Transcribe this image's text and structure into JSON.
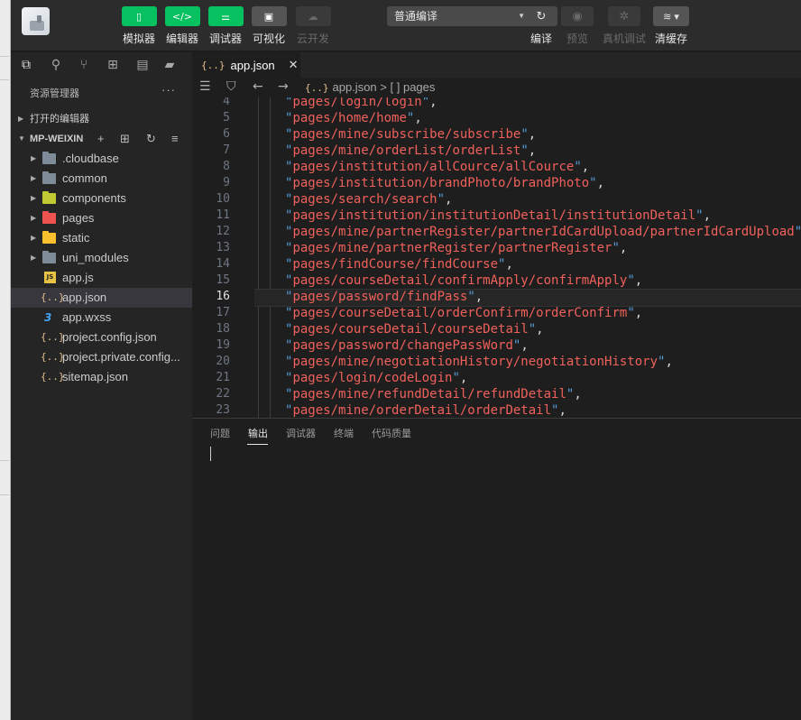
{
  "toolbar": {
    "buttons": [
      {
        "label": "模拟器"
      },
      {
        "label": "编辑器"
      },
      {
        "label": "调试器"
      },
      {
        "label": "可视化"
      },
      {
        "label": "云开发"
      }
    ],
    "compile_mode": "普通编译",
    "right_buttons": [
      {
        "label": "编译"
      },
      {
        "label": "预览"
      },
      {
        "label": "真机调试"
      },
      {
        "label": "清缓存"
      }
    ]
  },
  "tab": {
    "label": "app.json"
  },
  "breadcrumb": {
    "file": "app.json",
    "separator": ">",
    "node_icon": "[ ]",
    "node": "pages"
  },
  "sidebar": {
    "title": "资源管理器",
    "open_editors": "打开的编辑器",
    "project": "MP-WEIXIN",
    "items": [
      {
        "name": ".cloudbase",
        "kind": "folder",
        "color": "#7e8b99"
      },
      {
        "name": "common",
        "kind": "folder",
        "color": "#7e8b99"
      },
      {
        "name": "components",
        "kind": "folder",
        "color": "#c0ca33"
      },
      {
        "name": "pages",
        "kind": "folder",
        "color": "#ef5350"
      },
      {
        "name": "static",
        "kind": "folder",
        "color": "#fbc02d"
      },
      {
        "name": "uni_modules",
        "kind": "folder",
        "color": "#7e8b99"
      },
      {
        "name": "app.js",
        "kind": "js"
      },
      {
        "name": "app.json",
        "kind": "json",
        "selected": true
      },
      {
        "name": "app.wxss",
        "kind": "css"
      },
      {
        "name": "project.config.json",
        "kind": "json"
      },
      {
        "name": "project.private.config...",
        "kind": "json"
      },
      {
        "name": "sitemap.json",
        "kind": "json"
      }
    ]
  },
  "editor": {
    "current_line": 16,
    "lines": [
      {
        "n": "4",
        "text": "pages/login/login"
      },
      {
        "n": "5",
        "text": "pages/home/home"
      },
      {
        "n": "6",
        "text": "pages/mine/subscribe/subscribe"
      },
      {
        "n": "7",
        "text": "pages/mine/orderList/orderList"
      },
      {
        "n": "8",
        "text": "pages/institution/allCource/allCource"
      },
      {
        "n": "9",
        "text": "pages/institution/brandPhoto/brandPhoto"
      },
      {
        "n": "10",
        "text": "pages/search/search"
      },
      {
        "n": "11",
        "text": "pages/institution/institutionDetail/institutionDetail"
      },
      {
        "n": "12",
        "text": "pages/mine/partnerRegister/partnerIdCardUpload/partnerIdCardUpload"
      },
      {
        "n": "13",
        "text": "pages/mine/partnerRegister/partnerRegister"
      },
      {
        "n": "14",
        "text": "pages/findCourse/findCourse"
      },
      {
        "n": "15",
        "text": "pages/courseDetail/confirmApply/confirmApply"
      },
      {
        "n": "16",
        "text": "pages/password/findPass"
      },
      {
        "n": "17",
        "text": "pages/courseDetail/orderConfirm/orderConfirm"
      },
      {
        "n": "18",
        "text": "pages/courseDetail/courseDetail"
      },
      {
        "n": "19",
        "text": "pages/password/changePassWord"
      },
      {
        "n": "20",
        "text": "pages/mine/negotiationHistory/negotiationHistory"
      },
      {
        "n": "21",
        "text": "pages/login/codeLogin"
      },
      {
        "n": "22",
        "text": "pages/mine/refundDetail/refundDetail"
      },
      {
        "n": "23",
        "text": "pages/mine/orderDetail/orderDetail"
      }
    ]
  },
  "panel": {
    "tabs": [
      {
        "label": "问题"
      },
      {
        "label": "输出",
        "active": true
      },
      {
        "label": "调试器"
      },
      {
        "label": "终端"
      },
      {
        "label": "代码质量"
      }
    ]
  }
}
